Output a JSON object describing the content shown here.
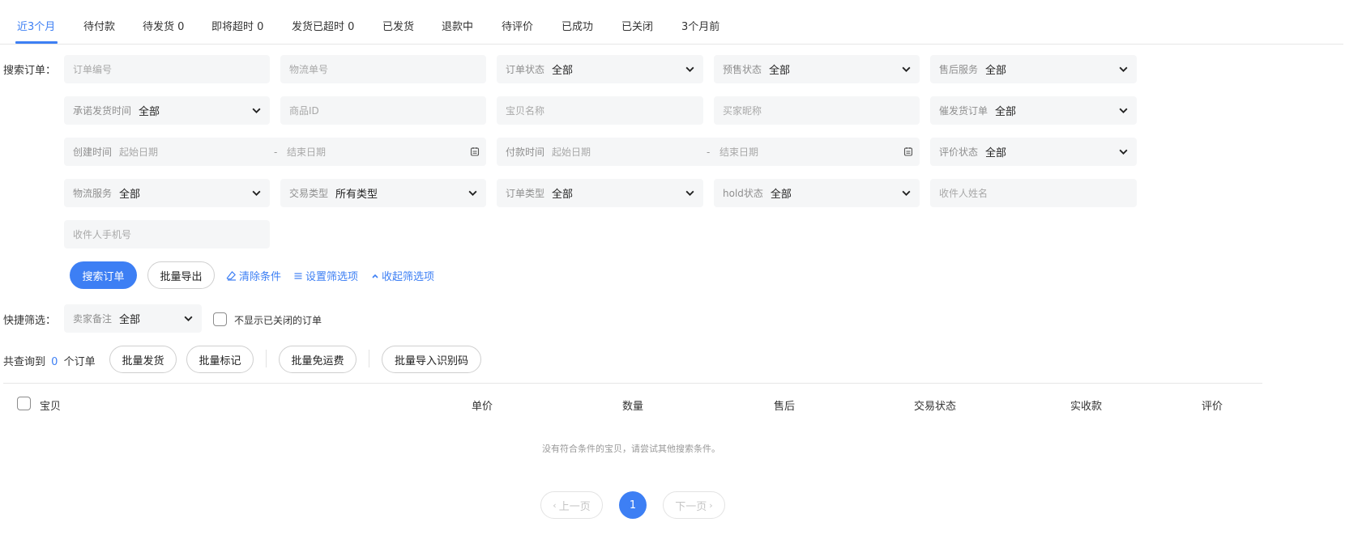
{
  "tabs": [
    {
      "label": "近3个月",
      "active": true
    },
    {
      "label": "待付款"
    },
    {
      "label": "待发货 0"
    },
    {
      "label": "即将超时 0"
    },
    {
      "label": "发货已超时 0"
    },
    {
      "label": "已发货"
    },
    {
      "label": "退款中"
    },
    {
      "label": "待评价"
    },
    {
      "label": "已成功"
    },
    {
      "label": "已关闭"
    },
    {
      "label": "3个月前"
    }
  ],
  "search": {
    "label": "搜索订单：",
    "order_no_placeholder": "订单编号",
    "logistics_no_placeholder": "物流单号",
    "order_status": {
      "label": "订单状态",
      "value": "全部"
    },
    "presale_status": {
      "label": "预售状态",
      "value": "全部"
    },
    "after_sale": {
      "label": "售后服务",
      "value": "全部"
    },
    "promised_ship_time": {
      "label": "承诺发货时间",
      "value": "全部"
    },
    "product_id_placeholder": "商品ID",
    "item_name_placeholder": "宝贝名称",
    "buyer_nick_placeholder": "买家昵称",
    "urge_ship": {
      "label": "催发货订单",
      "value": "全部"
    },
    "created_time": {
      "label": "创建时间",
      "start": "起始日期",
      "sep": "-",
      "end": "结束日期"
    },
    "paid_time": {
      "label": "付款时间",
      "start": "起始日期",
      "sep": "-",
      "end": "结束日期"
    },
    "review_status": {
      "label": "评价状态",
      "value": "全部"
    },
    "logistics_service": {
      "label": "物流服务",
      "value": "全部"
    },
    "trade_type": {
      "label": "交易类型",
      "value": "所有类型"
    },
    "order_type": {
      "label": "订单类型",
      "value": "全部"
    },
    "hold_status": {
      "label": "hold状态",
      "value": "全部"
    },
    "receiver_name_placeholder": "收件人姓名",
    "receiver_phone_placeholder": "收件人手机号"
  },
  "actions": {
    "search_button": "搜索订单",
    "export_button": "批量导出",
    "clear_link": "清除条件",
    "settings_link": "设置筛选项",
    "collapse_link": "收起筛选项"
  },
  "quick_filter": {
    "label": "快捷筛选：",
    "seller_note": {
      "label": "卖家备注",
      "value": "全部"
    },
    "hide_closed_label": "不显示已关闭的订单"
  },
  "summary": {
    "prefix": "共查询到",
    "count": "0",
    "suffix": "个订单"
  },
  "bulk_actions": {
    "ship": "批量发货",
    "mark": "批量标记",
    "free_shipping": "批量免运费",
    "import_code": "批量导入识别码"
  },
  "table": {
    "headers": [
      "宝贝",
      "单价",
      "数量",
      "售后",
      "交易状态",
      "实收款",
      "评价"
    ],
    "empty_text": "没有符合条件的宝贝，请尝试其他搜索条件。"
  },
  "pagination": {
    "prev": "上一页",
    "current": "1",
    "next": "下一页"
  },
  "colors": {
    "accent": "#3d7ff4",
    "field_bg": "#f5f6f7"
  }
}
